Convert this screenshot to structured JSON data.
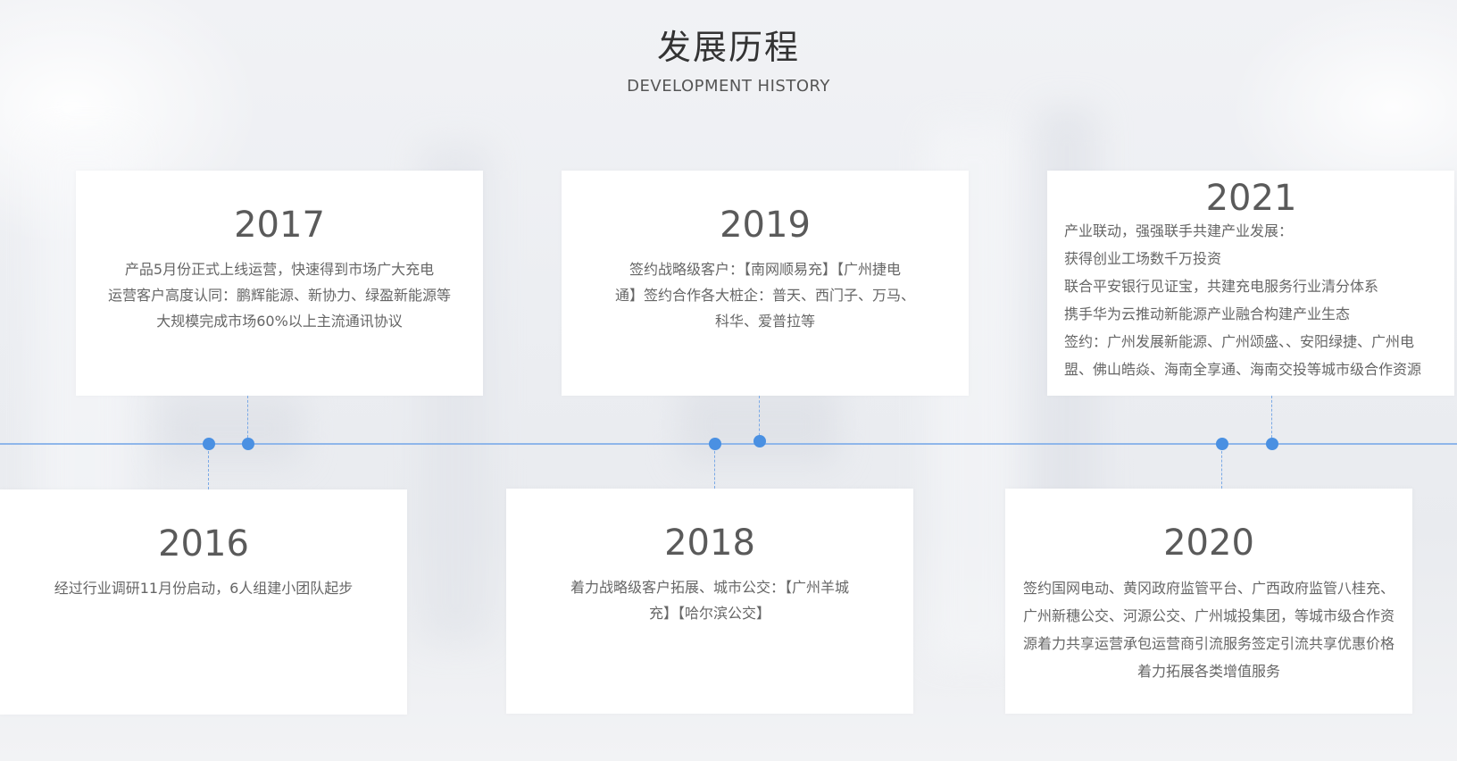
{
  "header": {
    "title": "发展历程",
    "subtitle": "DEVELOPMENT HISTORY"
  },
  "colors": {
    "axis": "#8fb6ea",
    "dot": "#4a90e2"
  },
  "milestones_top": [
    {
      "year": "2017",
      "lines": [
        "产品5月份正式上线运营，快速得到市场广大充电",
        "运营客户高度认同：鹏辉能源、新协力、绿盈新能源等",
        "大规模完成市场60%以上主流通讯协议"
      ]
    },
    {
      "year": "2019",
      "lines": [
        "签约战略级客户：【南网顺易充】【广州捷电",
        "通】签约合作各大桩企：普天、西门子、万马、",
        "科华、爱普拉等"
      ]
    },
    {
      "year": "2021",
      "lines": [
        "产业联动，强强联手共建产业发展：",
        "获得创业工场数千万投资",
        "联合平安银行见证宝，共建充电服务行业清分体系",
        "携手华为云推动新能源产业融合构建产业生态",
        "签约：广州发展新能源、广州颂盛、、安阳绿捷、广州电",
        "盟、佛山皓焱、海南全享通、海南交投等城市级合作资源"
      ]
    }
  ],
  "milestones_bottom": [
    {
      "year": "2016",
      "lines": [
        "经过行业调研11月份启动，6人组建小团队起步"
      ]
    },
    {
      "year": "2018",
      "lines": [
        "着力战略级客户拓展、城市公交：【广州羊城",
        "充】【哈尔滨公交】"
      ]
    },
    {
      "year": "2020",
      "lines": [
        "签约国网电动、黄冈政府监管平台、广西政府监管八桂充、",
        "广州新穗公交、河源公交、广州城投集团，等城市级合作资",
        "源着力共享运营承包运营商引流服务签定引流共享优惠价格",
        "着力拓展各类增值服务"
      ]
    }
  ]
}
